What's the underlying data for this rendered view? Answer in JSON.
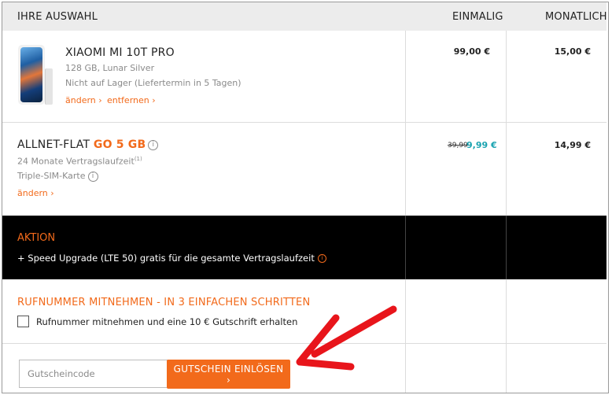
{
  "header": {
    "col_selection": "IHRE AUSWAHL",
    "col_once": "EINMALIG",
    "col_monthly": "MONATLICH"
  },
  "device": {
    "name": "XIAOMI MI 10T PRO",
    "spec": "128 GB, Lunar Silver",
    "availability": "Nicht auf Lager (Liefertermin in 5 Tagen)",
    "change_link": "ändern",
    "remove_link": "entfernen",
    "price_once": "99,00 €",
    "price_monthly": "15,00 €"
  },
  "tariff": {
    "name_prefix": "ALLNET-FLAT ",
    "name_highlight": "GO 5 GB",
    "contract": "24 Monate Vertragslaufzeit",
    "contract_footnote": "(1)",
    "sim": "Triple-SIM-Karte",
    "change_link": "ändern",
    "price_once_old": "39,99",
    "price_once": "9,99 €",
    "price_monthly": "14,99 €"
  },
  "promo": {
    "heading": "AKTION",
    "text": "+ Speed Upgrade (LTE 50) gratis für die gesamte Vertragslaufzeit"
  },
  "porting": {
    "heading": "RUFNUMMER MITNEHMEN - IN 3 EINFACHEN SCHRITTEN",
    "checkbox_label": "Rufnummer mitnehmen und eine 10 € Gutschrift erhalten"
  },
  "voucher": {
    "placeholder": "Gutscheincode",
    "button_label": "GUTSCHEIN EINLÖSEN ›"
  },
  "colors": {
    "accent": "#f26a1b",
    "teal": "#1aa3b0",
    "annotation_arrow": "#e8151b"
  },
  "icons": [
    "info-icon",
    "chevron-right-icon",
    "checkbox-icon",
    "red-arrow-annotation"
  ]
}
